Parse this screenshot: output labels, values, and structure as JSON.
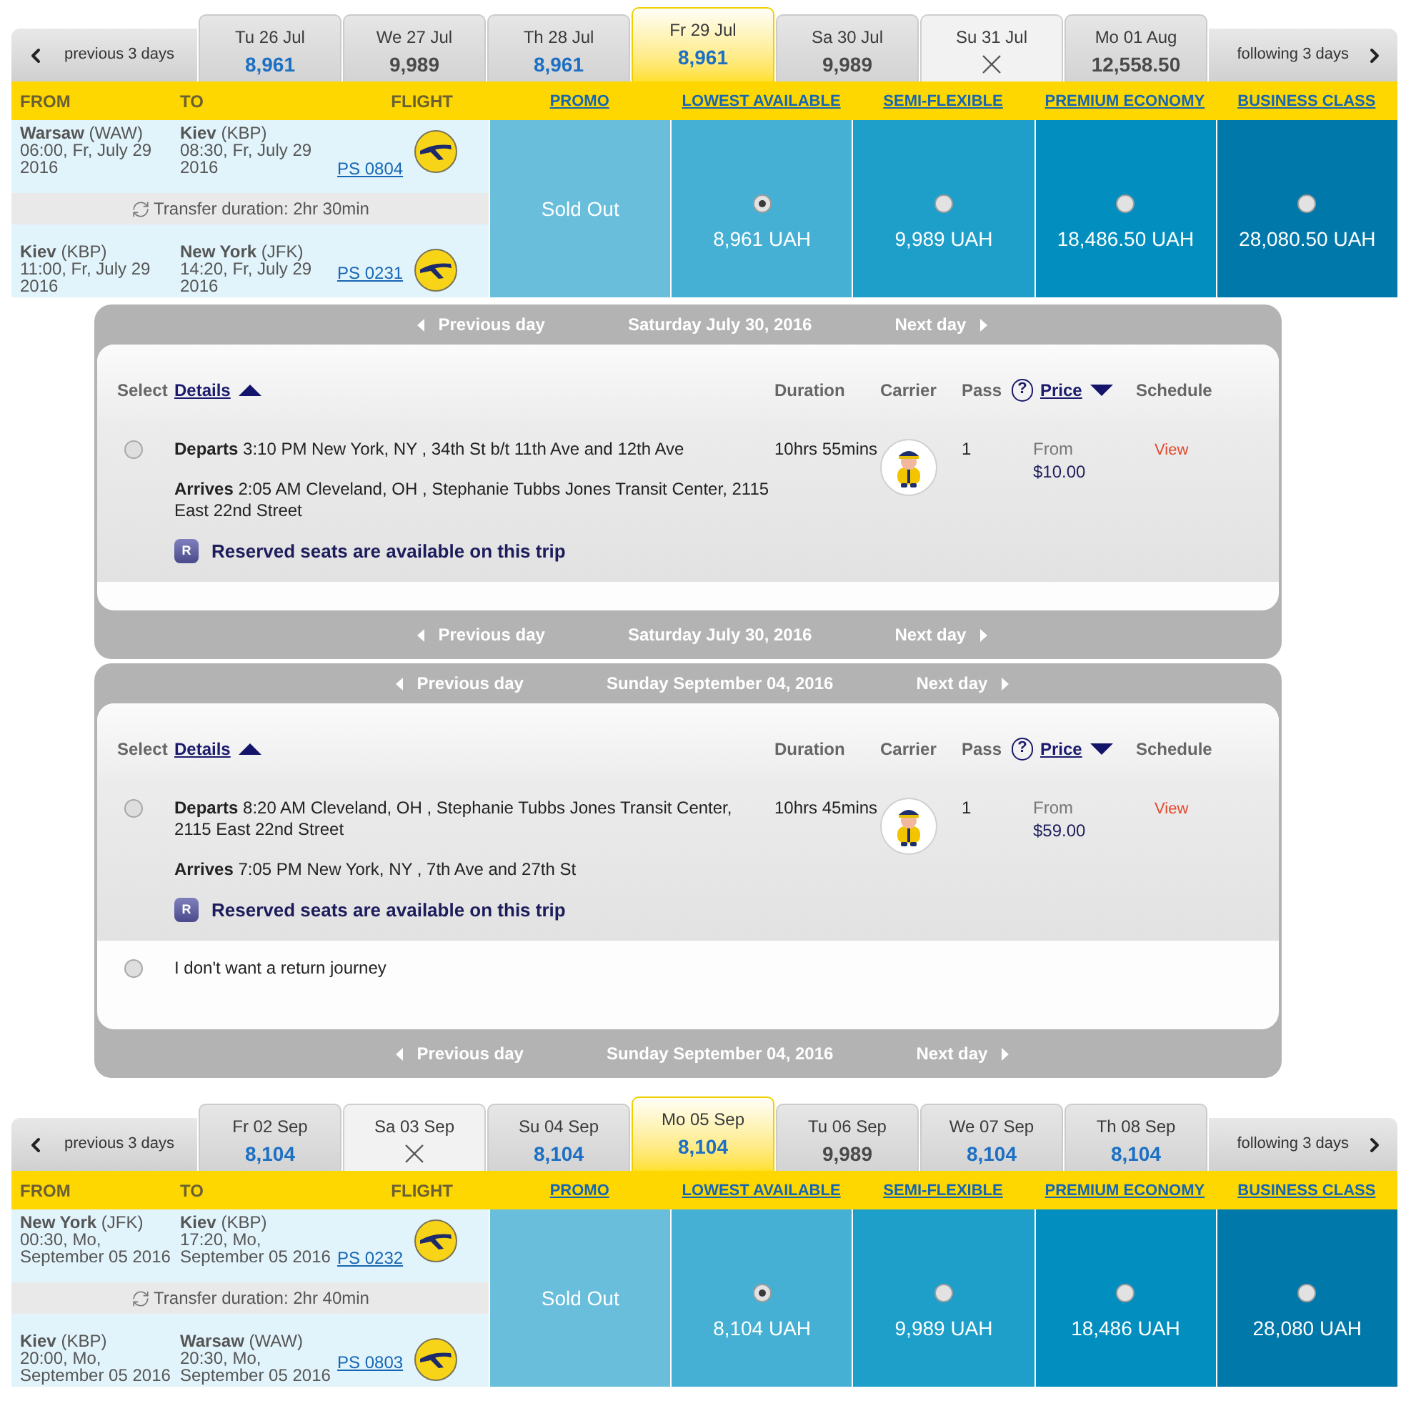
{
  "outbound_flights": {
    "previous_days": "previous 3 days",
    "following_days": "following 3 days",
    "dates": [
      {
        "day": "Tu 26 Jul",
        "price": "8,961",
        "highlighted": true,
        "available": true,
        "selected": false
      },
      {
        "day": "We 27 Jul",
        "price": "9,989",
        "highlighted": false,
        "available": true,
        "selected": false
      },
      {
        "day": "Th 28 Jul",
        "price": "8,961",
        "highlighted": true,
        "available": true,
        "selected": false
      },
      {
        "day": "Fr 29 Jul",
        "price": "8,961",
        "highlighted": true,
        "available": true,
        "selected": true
      },
      {
        "day": "Sa 30 Jul",
        "price": "9,989",
        "highlighted": false,
        "available": true,
        "selected": false
      },
      {
        "day": "Su 31 Jul",
        "available": false,
        "selected": false
      },
      {
        "day": "Mo 01 Aug",
        "price": "12,558.50",
        "highlighted": false,
        "available": true,
        "selected": false
      }
    ],
    "columns": [
      "FROM",
      "TO",
      "FLIGHT"
    ],
    "fare_classes": [
      "PROMO",
      "LOWEST AVAILABLE",
      "SEMI-FLEXIBLE",
      "PREMIUM ECONOMY",
      "BUSINESS CLASS"
    ],
    "segments": [
      {
        "from": "**Warsaw** (WAW)",
        "from_time": "06:00, Fr, July 29 2016",
        "to": "**Kiev** (KBP)",
        "to_time": "08:30, Fr, July 29 2016",
        "flight": "PS 0804"
      },
      {
        "from": "**Kiev** (KBP)",
        "from_time": "11:00, Fr, July 29 2016",
        "to": "**New York** (JFK)",
        "to_time": "14:20, Fr, July 29 2016",
        "flight": "PS 0231"
      }
    ],
    "transfer": "Transfer duration: 2hr 30min",
    "fares": [
      {
        "kind": "sold_out",
        "label": "Sold Out"
      },
      {
        "kind": "price",
        "price": "8,961 UAH",
        "selected": true
      },
      {
        "kind": "price",
        "price": "9,989 UAH",
        "selected": false
      },
      {
        "kind": "price",
        "price": "18,486.50 UAH",
        "selected": false
      },
      {
        "kind": "price",
        "price": "28,080.50 UAH",
        "selected": false
      }
    ]
  },
  "bus_trips": [
    {
      "nav_top": {
        "previous": "Previous day",
        "date": "Saturday July 30, 2016",
        "next": "Next day"
      },
      "headers": {
        "select": "Select",
        "details": "Details",
        "duration": "Duration",
        "carrier": "Carrier",
        "pass": "Pass",
        "help": "?",
        "price": "Price",
        "schedule": "Schedule"
      },
      "options": [
        {
          "kind": "trip",
          "selected": false,
          "departs": "**Departs** 3:10 PM New York, NY , 34th St b/t 11th Ave and 12th Ave",
          "arrives": "**Arrives** 2:05 AM Cleveland, OH , Stephanie Tubbs Jones Transit Center, 2115 East 22nd Street",
          "reserved_badge": "R",
          "reserved": "Reserved seats are available on this trip",
          "duration": "10hrs 55mins",
          "pass": "1",
          "price_label": "From",
          "price": "$10.00",
          "schedule": "View"
        }
      ],
      "nav_bottom": {
        "previous": "Previous day",
        "date": "Saturday July 30, 2016",
        "next": "Next day"
      }
    },
    {
      "nav_top": {
        "previous": "Previous day",
        "date": "Sunday September 04, 2016",
        "next": "Next day"
      },
      "headers": {
        "select": "Select",
        "details": "Details",
        "duration": "Duration",
        "carrier": "Carrier",
        "pass": "Pass",
        "help": "?",
        "price": "Price",
        "schedule": "Schedule"
      },
      "options": [
        {
          "kind": "trip",
          "selected": false,
          "departs": "**Departs** 8:20 AM Cleveland, OH , Stephanie Tubbs Jones Transit Center, 2115 East 22nd Street",
          "arrives": "**Arrives** 7:05 PM New York, NY , 7th Ave and 27th St",
          "reserved_badge": "R",
          "reserved": "Reserved seats are available on this trip",
          "duration": "10hrs 45mins",
          "pass": "1",
          "price_label": "From",
          "price": "$59.00",
          "schedule": "View"
        },
        {
          "kind": "no_return",
          "selected": false,
          "label": "I don't want a return journey"
        }
      ],
      "nav_bottom": {
        "previous": "Previous day",
        "date": "Sunday September 04, 2016",
        "next": "Next day"
      }
    }
  ],
  "return_flights": {
    "previous_days": "previous 3 days",
    "following_days": "following 3 days",
    "dates": [
      {
        "day": "Fr 02 Sep",
        "price": "8,104",
        "highlighted": true,
        "available": true,
        "selected": false
      },
      {
        "day": "Sa 03 Sep",
        "available": false,
        "selected": false
      },
      {
        "day": "Su 04 Sep",
        "price": "8,104",
        "highlighted": true,
        "available": true,
        "selected": false
      },
      {
        "day": "Mo 05 Sep",
        "price": "8,104",
        "highlighted": true,
        "available": true,
        "selected": true
      },
      {
        "day": "Tu 06 Sep",
        "price": "9,989",
        "highlighted": false,
        "available": true,
        "selected": false
      },
      {
        "day": "We 07 Sep",
        "price": "8,104",
        "highlighted": true,
        "available": true,
        "selected": false
      },
      {
        "day": "Th 08 Sep",
        "price": "8,104",
        "highlighted": true,
        "available": true,
        "selected": false
      }
    ],
    "columns": [
      "FROM",
      "TO",
      "FLIGHT"
    ],
    "fare_classes": [
      "PROMO",
      "LOWEST AVAILABLE",
      "SEMI-FLEXIBLE",
      "PREMIUM ECONOMY",
      "BUSINESS CLASS"
    ],
    "segments": [
      {
        "from": "**New York** (JFK)",
        "from_time": "00:30, Mo, September 05 2016",
        "to": "**Kiev** (KBP)",
        "to_time": "17:20, Mo, September 05 2016",
        "flight": "PS 0232"
      },
      {
        "from": "**Kiev** (KBP)",
        "from_time": "20:00, Mo, September 05 2016",
        "to": "**Warsaw** (WAW)",
        "to_time": "20:30, Mo, September 05 2016",
        "flight": "PS 0803"
      }
    ],
    "transfer": "Transfer duration: 2hr 40min",
    "fares": [
      {
        "kind": "sold_out",
        "label": "Sold Out"
      },
      {
        "kind": "price",
        "price": "8,104 UAH",
        "selected": true
      },
      {
        "kind": "price",
        "price": "9,989 UAH",
        "selected": false
      },
      {
        "kind": "price",
        "price": "18,486 UAH",
        "selected": false
      },
      {
        "kind": "price",
        "price": "28,080 UAH",
        "selected": false
      }
    ]
  }
}
